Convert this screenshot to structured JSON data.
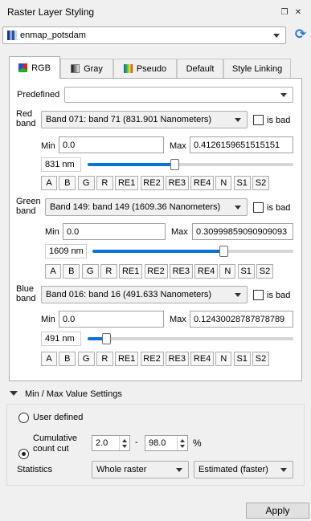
{
  "title": "Raster Layer Styling",
  "layer_combo": {
    "value": "enmap_potsdam"
  },
  "tabs": [
    {
      "label": "RGB"
    },
    {
      "label": "Gray"
    },
    {
      "label": "Pseudo"
    },
    {
      "label": "Default"
    },
    {
      "label": "Style Linking"
    }
  ],
  "rgb": {
    "predefined_label": "Predefined",
    "predefined_value": "",
    "min_label": "Min",
    "max_label": "Max",
    "is_bad_label": "is bad",
    "band_buttons": [
      "A",
      "B",
      "G",
      "R",
      "RE1",
      "RE2",
      "RE3",
      "RE4",
      "N",
      "S1",
      "S2"
    ],
    "red": {
      "label": "Red\nband",
      "band": "Band 071: band 71 (831.901 Nanometers)",
      "min": "0.0",
      "max": "0.4126159651515151",
      "wavelength": "831 nm",
      "slider_fraction": 0.42,
      "is_bad": false
    },
    "green": {
      "label": "Green\nband",
      "band": "Band 149: band 149 (1609.36 Nanometers)",
      "min": "0.0",
      "max": "0.30999859090909093",
      "wavelength": "1609 nm",
      "slider_fraction": 0.65,
      "is_bad": false
    },
    "blue": {
      "label": "Blue\nband",
      "band": "Band 016: band 16 (491.633 Nanometers)",
      "min": "0.0",
      "max": "0.12430028787878789",
      "wavelength": "491 nm",
      "slider_fraction": 0.09,
      "is_bad": false
    }
  },
  "minmax": {
    "header": "Min / Max Value Settings",
    "user_defined_label": "User defined",
    "cumulative_label": "Cumulative\ncount cut",
    "cumulative_selected": true,
    "cut_low": "2.0",
    "cut_sep": "-",
    "cut_high": "98.0",
    "percent_label": "%",
    "statistics_label": "Statistics",
    "statistics_value": "Whole raster",
    "accuracy_value": "Estimated (faster)"
  },
  "apply_label": "Apply",
  "colors": {
    "accent": "#0a74d6",
    "panel_bg": "#f0f0f0"
  }
}
